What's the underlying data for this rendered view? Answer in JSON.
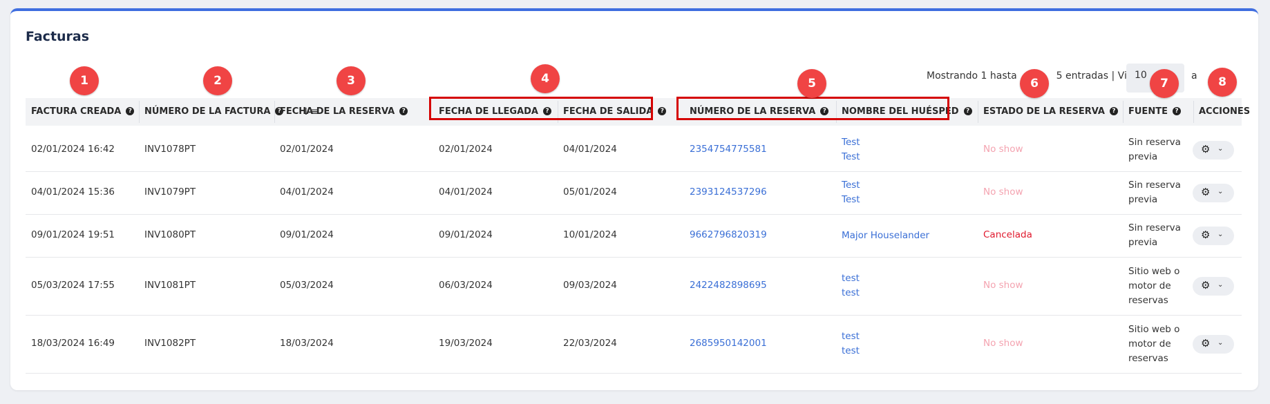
{
  "title": "Facturas",
  "pagination": {
    "showing_text": "Mostrando 1 hasta",
    "showing_text_after": "5 entradas | Vista",
    "page_size": "10",
    "after_label": "a"
  },
  "columns": [
    {
      "key": "created",
      "label": "FACTURA CREADA"
    },
    {
      "key": "invoice_no",
      "label": "NÚMERO DE LA FACTURA"
    },
    {
      "key": "booking_date",
      "label": "FECHA DE LA RESERVA"
    },
    {
      "key": "arrival",
      "label": "FECHA DE LLEGADA"
    },
    {
      "key": "departure",
      "label": "FECHA DE SALIDA"
    },
    {
      "key": "booking_no",
      "label": "NÚMERO DE LA RESERVA"
    },
    {
      "key": "guest",
      "label": "NOMBRE DEL HUÉSPED"
    },
    {
      "key": "status",
      "label": "ESTADO DE LA RESERVA"
    },
    {
      "key": "source",
      "label": "FUENTE"
    },
    {
      "key": "actions",
      "label": "ACCIONES"
    }
  ],
  "badges": [
    "1",
    "2",
    "3",
    "4",
    "5",
    "6",
    "7",
    "8"
  ],
  "rows": [
    {
      "created": "02/01/2024 16:42",
      "invoice_no": "INV1078PT",
      "booking_date": "02/01/2024",
      "arrival": "02/01/2024",
      "departure": "04/01/2024",
      "booking_no": "2354754775581",
      "guest": [
        "Test",
        "Test"
      ],
      "status": "No show",
      "source": [
        "Sin reserva",
        "previa"
      ]
    },
    {
      "created": "04/01/2024 15:36",
      "invoice_no": "INV1079PT",
      "booking_date": "04/01/2024",
      "arrival": "04/01/2024",
      "departure": "05/01/2024",
      "booking_no": "2393124537296",
      "guest": [
        "Test",
        "Test"
      ],
      "status": "No show",
      "source": [
        "Sin reserva",
        "previa"
      ]
    },
    {
      "created": "09/01/2024 19:51",
      "invoice_no": "INV1080PT",
      "booking_date": "09/01/2024",
      "arrival": "09/01/2024",
      "departure": "10/01/2024",
      "booking_no": "9662796820319",
      "guest": [
        "Major Houselander"
      ],
      "status": "Cancelada",
      "source": [
        "Sin reserva",
        "previa"
      ]
    },
    {
      "created": "05/03/2024 17:55",
      "invoice_no": "INV1081PT",
      "booking_date": "05/03/2024",
      "arrival": "06/03/2024",
      "departure": "09/03/2024",
      "booking_no": "2422482898695",
      "guest": [
        "test",
        "test"
      ],
      "status": "No show",
      "source": [
        "Sitio web o",
        "motor de",
        "reservas"
      ]
    },
    {
      "created": "18/03/2024 16:49",
      "invoice_no": "INV1082PT",
      "booking_date": "18/03/2024",
      "arrival": "19/03/2024",
      "departure": "22/03/2024",
      "booking_no": "2685950142001",
      "guest": [
        "test",
        "test"
      ],
      "status": "No show",
      "source": [
        "Sitio web o",
        "motor de",
        "reservas"
      ]
    }
  ],
  "colors": {
    "accent_top": "#3f6ee0",
    "link": "#3a6fd6",
    "status_no_show": "#f4a3b0",
    "status_cancelled": "#e0192d",
    "badge": "#f04444",
    "highlight": "#d50000"
  },
  "icons": {
    "help": "question-circle-icon",
    "sort": "sort-ascending-icon",
    "gear": "gear-icon",
    "chevron": "chevron-down-icon"
  }
}
